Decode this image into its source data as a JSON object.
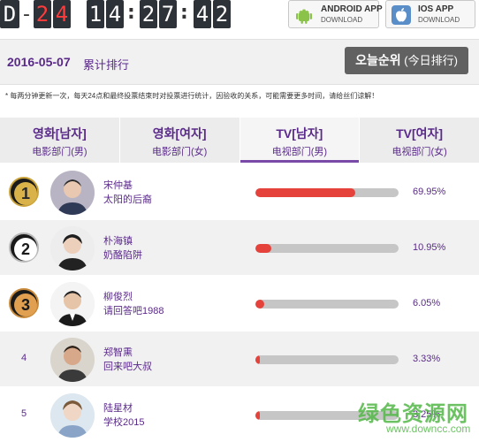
{
  "countdown": {
    "d_letter": "D",
    "d_dash": "-",
    "days": [
      "2",
      "4"
    ],
    "hours": [
      "1",
      "4"
    ],
    "minutes": [
      "2",
      "7"
    ],
    "seconds": [
      "4",
      "2"
    ],
    "sep": ":"
  },
  "apps": {
    "android": {
      "title": "ANDROID APP",
      "sub": "DOWNLOAD",
      "icon": "android-icon"
    },
    "ios": {
      "title": "IOS APP",
      "sub": "DOWNLOAD",
      "icon": "apple-icon"
    }
  },
  "header": {
    "date": "2016-05-07",
    "cumulative": "累计排行",
    "today_ko": "오늘순위",
    "today_cn": "(今日排行)"
  },
  "note": "* 每两分钟更新一次，每天24点和最终投票结束时对投票进行统计，因验收的关系，可能需要更多时间，请给丝们谅解！",
  "tabs": [
    {
      "l1": "영화[남자]",
      "l2": "电影部门(男)",
      "active": false
    },
    {
      "l1": "영화[여자]",
      "l2": "电影部门(女)",
      "active": false
    },
    {
      "l1": "TV[남자]",
      "l2": "电视部门(男)",
      "active": true
    },
    {
      "l1": "TV[여자]",
      "l2": "电视部门(女)",
      "active": false
    }
  ],
  "rankings": [
    {
      "rank": "1",
      "name": "宋仲基",
      "drama": "太阳的后裔",
      "percent": "69.95%",
      "share": 0.7
    },
    {
      "rank": "2",
      "name": "朴海镇",
      "drama": "奶酪陷阱",
      "percent": "10.95%",
      "share": 0.11
    },
    {
      "rank": "3",
      "name": "柳俊烈",
      "drama": "请回答吧1988",
      "percent": "6.05%",
      "share": 0.06
    },
    {
      "rank": "4",
      "name": "郑智熏",
      "drama": "回来吧大叔",
      "percent": "3.33%",
      "share": 0.033
    },
    {
      "rank": "5",
      "name": "陆星材",
      "drama": "学校2015",
      "percent": "3.25%",
      "share": 0.0325
    }
  ],
  "colors": {
    "accent": "#5a2a8a",
    "bar_fill": "#e5423c",
    "bar_track": "#c6c6c6"
  },
  "watermark": {
    "line1": "绿色资源网",
    "line2": "www.downcc.com"
  }
}
